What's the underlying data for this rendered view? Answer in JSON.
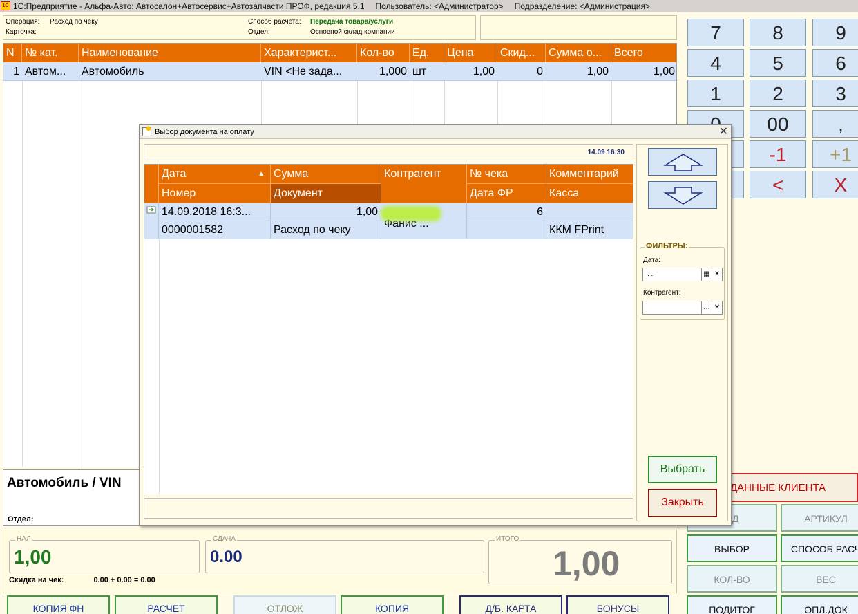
{
  "titlebar": {
    "logo": "1С",
    "app": "1С:Предприятие - Альфа-Авто: Автосалон+Автосервис+Автозапчасти ПРОФ, редакция 5.1",
    "user": "Пользователь: <Администратор>",
    "division": "Подразделение: <Администрация>"
  },
  "header": {
    "operation_label": "Операция:",
    "operation_value": "Расход по чеку",
    "card_label": "Карточка:",
    "payment_label": "Способ расчета:",
    "payment_value": "Передача товара/услуги",
    "dept_label": "Отдел:",
    "dept_value": "Основной склад компании"
  },
  "main_table": {
    "columns": [
      "N",
      "№ кат.",
      "Наименование",
      "Характерист...",
      "Кол-во",
      "Ед.",
      "Цена",
      "Скид...",
      "Сумма о...",
      "Всего"
    ],
    "rows": [
      [
        "1",
        "Автом...",
        "Автомобиль",
        "VIN <Не зада...",
        "1,000",
        "шт",
        "1,00",
        "0",
        "1,00",
        "1,00"
      ]
    ]
  },
  "info": {
    "item_title": "Автомобиль / VIN",
    "dept_label": "Отдел:"
  },
  "totals": {
    "cash_label": "НАЛ",
    "cash_value": "1,00",
    "change_label": "СДАЧА",
    "change_value": "0.00",
    "total_label": "ИТОГО",
    "total_value": "1,00",
    "discount_label": "Скидка на чек:",
    "discount_value": "0.00 + 0.00 = 0.00"
  },
  "bottom_buttons": [
    "КОПИЯ ФН",
    "РАСЧЕТ",
    "ОТЛОЖ",
    "КОПИЯ",
    "Д/Б. КАРТА",
    "БОНУСЫ"
  ],
  "keypad": {
    "keys": [
      "7",
      "8",
      "9",
      "4",
      "5",
      "6",
      "1",
      "2",
      "3",
      "0",
      "00",
      ","
    ],
    "minus_one": "-1",
    "plus_one": "+1",
    "backspace": "<",
    "clear": "X"
  },
  "client_button": "ДАННЫЕ КЛИЕНТА",
  "side_buttons": {
    "code": "ОД",
    "article": "АРТИКУЛ",
    "select": "ВЫБОР",
    "payment_method": "СПОСОБ РАСЧ",
    "quantity": "КОЛ-ВО",
    "weight": "ВЕС",
    "subtotal": "ПОДИТОГ",
    "pay_doc": "ОПЛ.ДОК"
  },
  "dialog": {
    "title": "Выбор документа на оплату",
    "datetime": "14.09 16:30",
    "columns_top": [
      "Дата",
      "Сумма",
      "Контрагент",
      "№ чека",
      "Комментарий"
    ],
    "columns_bottom": [
      "Номер",
      "Документ",
      "Дата ФР",
      "Касса"
    ],
    "row": {
      "date": "14.09.2018 16:3...",
      "sum": "1,00",
      "contractor": "Фанис ...",
      "check_no": "6",
      "comment": "",
      "number": "0000001582",
      "document": "Расход по чеку",
      "fr_date": "",
      "cash_register": "ККМ FPrint"
    },
    "filters_label": "ФИЛЬТРЫ:",
    "filter_date_label": "Дата:",
    "filter_date_value": " .  .",
    "filter_contractor_label": "Контрагент:",
    "filter_contractor_value": "",
    "choose_button": "Выбрать",
    "close_button": "Закрыть"
  }
}
